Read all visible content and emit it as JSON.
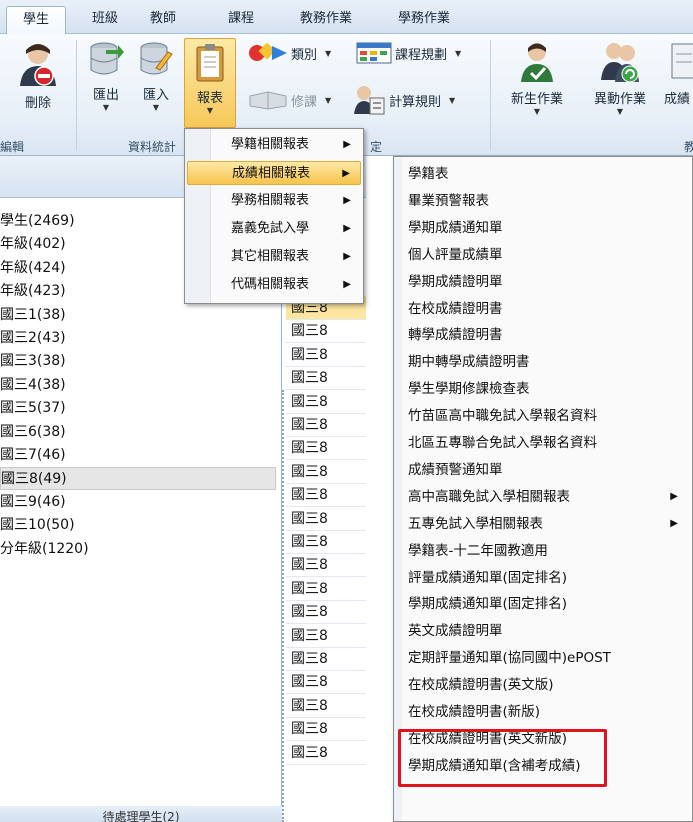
{
  "tabs": [
    "學生",
    "班級",
    "教師",
    "課程",
    "教務作業",
    "學務作業"
  ],
  "ribbon": {
    "delete_label": "刪除",
    "export_label": "匯出",
    "import_label": "匯入",
    "report_label": "報表",
    "category_label": "類別",
    "course_plan_label": "課程規劃",
    "retake_label": "修課",
    "calc_rule_label": "計算規則",
    "new_student_label": "新生作業",
    "transfer_label": "異動作業",
    "grade_label": "成績",
    "group_edit": "編輯",
    "group_data": "資料統計",
    "group_settings": "定",
    "group_right": "教"
  },
  "left_tree": {
    "items": [
      "學生(2469)",
      "年級(402)",
      "年級(424)",
      "年級(423)",
      "國三1(38)",
      "國三2(43)",
      "國三3(38)",
      "國三4(38)",
      "國三5(37)",
      "國三6(38)",
      "國三7(46)",
      "國三8(49)",
      "國三9(46)",
      "國三10(50)",
      "分年級(1220)"
    ],
    "selected_index": 11,
    "footer": "待處理學生(2)"
  },
  "mid_column": {
    "rows": [
      "國三8",
      "國三8",
      "國三8",
      "國三8",
      "國三8",
      "國三8",
      "國三8",
      "國三8",
      "國三8",
      "國三8",
      "國三8",
      "國三8",
      "國三8",
      "國三8",
      "國三8",
      "國三8",
      "國三8",
      "國三8",
      "國三8",
      "國三8"
    ]
  },
  "menu_reports": {
    "items": [
      "學籍相關報表",
      "成績相關報表",
      "學務相關報表",
      "嘉義免試入學",
      "其它相關報表",
      "代碼相關報表"
    ],
    "highlighted_index": 1
  },
  "menu_grades": {
    "items": [
      {
        "label": "學籍表",
        "submenu": false
      },
      {
        "label": "畢業預警報表",
        "submenu": false
      },
      {
        "label": "學期成績通知單",
        "submenu": false
      },
      {
        "label": "個人評量成績單",
        "submenu": false
      },
      {
        "label": "學期成績證明單",
        "submenu": false
      },
      {
        "label": "在校成績證明書",
        "submenu": false
      },
      {
        "label": "轉學成績證明書",
        "submenu": false
      },
      {
        "label": "期中轉學成績證明書",
        "submenu": false
      },
      {
        "label": "學生學期修課檢查表",
        "submenu": false
      },
      {
        "label": "竹苗區高中職免試入學報名資料",
        "submenu": false
      },
      {
        "label": "北區五專聯合免試入學報名資料",
        "submenu": false
      },
      {
        "label": "成績預警通知單",
        "submenu": false
      },
      {
        "label": "高中高職免試入學相關報表",
        "submenu": true
      },
      {
        "label": "五專免試入學相關報表",
        "submenu": true
      },
      {
        "label": "學籍表-十二年國教適用",
        "submenu": false
      },
      {
        "label": "評量成績通知單(固定排名)",
        "submenu": false
      },
      {
        "label": "學期成績通知單(固定排名)",
        "submenu": false
      },
      {
        "label": "英文成績證明單",
        "submenu": false
      },
      {
        "label": "定期評量通知單(協同國中)ePOST",
        "submenu": false
      },
      {
        "label": "在校成績證明書(英文版)",
        "submenu": false
      },
      {
        "label": "在校成績證明書(新版)",
        "submenu": false
      },
      {
        "label": "在校成績證明書(英文新版)",
        "submenu": false
      },
      {
        "label": "學期成績通知單(含補考成績)",
        "submenu": false
      }
    ],
    "highlight_color": "#e0141e"
  }
}
